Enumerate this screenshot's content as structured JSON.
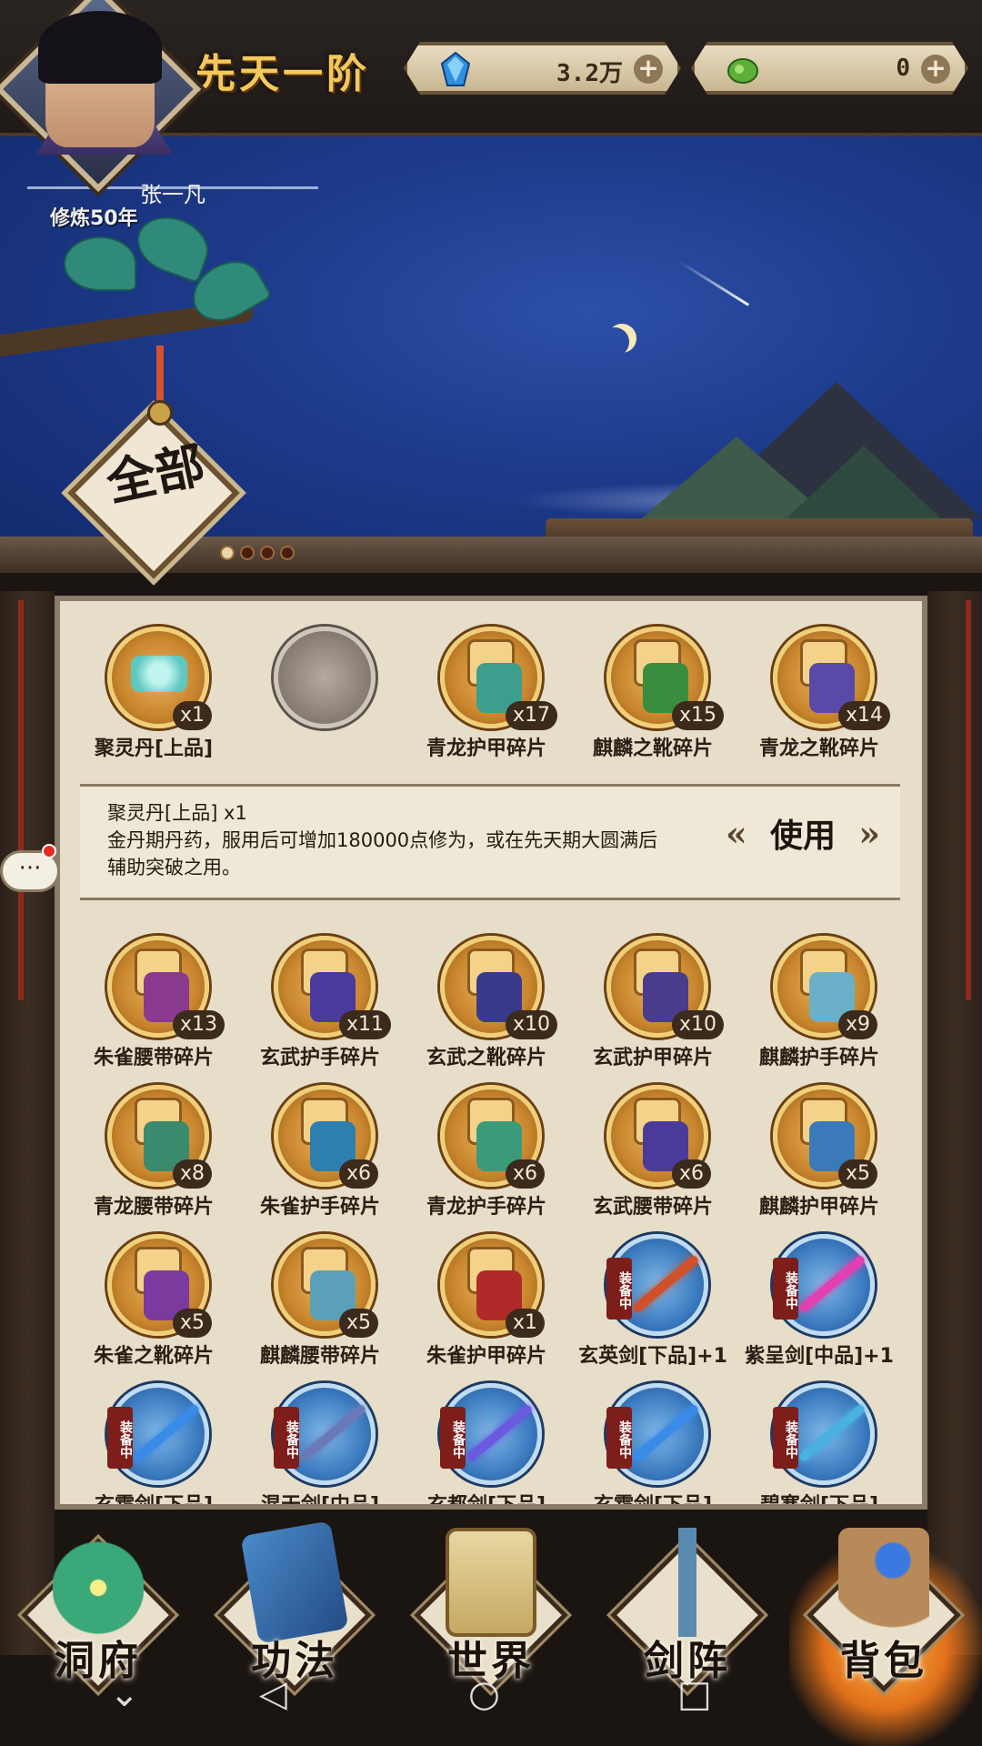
{
  "header": {
    "rank_title": "先天一阶",
    "resources": [
      {
        "icon": "crystal-icon",
        "value": "3.2万",
        "color": "#2f8fe0"
      },
      {
        "icon": "jade-icon",
        "value": "0",
        "color": "#5cb03a"
      }
    ],
    "plus_label": "+"
  },
  "player": {
    "name": "张一凡",
    "cultivation": "修炼50年"
  },
  "filter": {
    "label": "全部",
    "pages": 4,
    "active_page": 0
  },
  "inventory": {
    "row1": [
      {
        "name": "聚灵丹[上品]",
        "qty": "x1",
        "kind": "pill"
      },
      {
        "name": "",
        "qty": "",
        "kind": "empty"
      },
      {
        "name": "青龙护甲碎片",
        "qty": "x17",
        "kind": "fragment",
        "tint": "#3d9e8e"
      },
      {
        "name": "麒麟之靴碎片",
        "qty": "x15",
        "kind": "fragment",
        "tint": "#3a8d3e"
      },
      {
        "name": "青龙之靴碎片",
        "qty": "x14",
        "kind": "fragment",
        "tint": "#5a4aa8"
      }
    ],
    "detail": {
      "title": "聚灵丹[上品]  x1",
      "line1": "金丹期丹药，服用后可增加180000点修为，或在先天期大圆满后",
      "line2": "辅助突破之用。",
      "use_label": "使用"
    },
    "rows": [
      [
        {
          "name": "朱雀腰带碎片",
          "qty": "x13",
          "kind": "fragment",
          "tint": "#8a3a8e"
        },
        {
          "name": "玄武护手碎片",
          "qty": "x11",
          "kind": "fragment",
          "tint": "#4a3a9e"
        },
        {
          "name": "玄武之靴碎片",
          "qty": "x10",
          "kind": "fragment",
          "tint": "#3a3a8a"
        },
        {
          "name": "玄武护甲碎片",
          "qty": "x10",
          "kind": "fragment",
          "tint": "#4a3c8c"
        },
        {
          "name": "麒麟护手碎片",
          "qty": "x9",
          "kind": "fragment",
          "tint": "#6ab0c8"
        }
      ],
      [
        {
          "name": "青龙腰带碎片",
          "qty": "x8",
          "kind": "fragment",
          "tint": "#3a8a6e"
        },
        {
          "name": "朱雀护手碎片",
          "qty": "x6",
          "kind": "fragment",
          "tint": "#2d7fb0"
        },
        {
          "name": "青龙护手碎片",
          "qty": "x6",
          "kind": "fragment",
          "tint": "#3a9a7a"
        },
        {
          "name": "玄武腰带碎片",
          "qty": "x6",
          "kind": "fragment",
          "tint": "#4a3a9a"
        },
        {
          "name": "麒麟护甲碎片",
          "qty": "x5",
          "kind": "fragment",
          "tint": "#3a7ab8"
        }
      ],
      [
        {
          "name": "朱雀之靴碎片",
          "qty": "x5",
          "kind": "fragment",
          "tint": "#7a3a9e"
        },
        {
          "name": "麒麟腰带碎片",
          "qty": "x5",
          "kind": "fragment",
          "tint": "#5aa0b8"
        },
        {
          "name": "朱雀护甲碎片",
          "qty": "x1",
          "kind": "fragment",
          "tint": "#b02a2a"
        },
        {
          "name": "玄英剑[下品]+1",
          "qty": "",
          "kind": "sword",
          "tint": "#d0502a",
          "equipped": "装备中"
        },
        {
          "name": "紫呈剑[中品]+1",
          "qty": "",
          "kind": "sword",
          "tint": "#e040b0",
          "equipped": "装备中"
        }
      ],
      [
        {
          "name": "玄霜剑[下品]",
          "qty": "",
          "kind": "sword",
          "tint": "#3a8ae8",
          "equipped": "装备中"
        },
        {
          "name": "混天剑[中品]",
          "qty": "",
          "kind": "sword",
          "tint": "#6a7ab8",
          "equipped": "装备中"
        },
        {
          "name": "玄都剑[下品]",
          "qty": "",
          "kind": "sword",
          "tint": "#6a5ae0",
          "equipped": "装备中"
        },
        {
          "name": "玄霜剑[下品]",
          "qty": "",
          "kind": "sword",
          "tint": "#3a8ae8",
          "equipped": "装备中"
        },
        {
          "name": "碧寒剑[下品]",
          "qty": "",
          "kind": "sword",
          "tint": "#4ab0e0",
          "equipped": "装备中"
        }
      ]
    ]
  },
  "chat": {
    "label": "···"
  },
  "bottom_nav": [
    {
      "label": "洞府",
      "icon": "cave-icon",
      "color": "#3aa878"
    },
    {
      "label": "功法",
      "icon": "scripture-icon",
      "color": "#3a7ab8"
    },
    {
      "label": "世界",
      "icon": "world-scroll-icon",
      "color": "#d8c48a"
    },
    {
      "label": "剑阵",
      "icon": "sword-formation-icon",
      "color": "#5a8ab0"
    },
    {
      "label": "背包",
      "icon": "bag-icon",
      "color": "#b88a5a",
      "active": true
    }
  ],
  "system_nav": {
    "back": "◁",
    "home": "○",
    "recent": "□",
    "collapse": "⌄"
  }
}
